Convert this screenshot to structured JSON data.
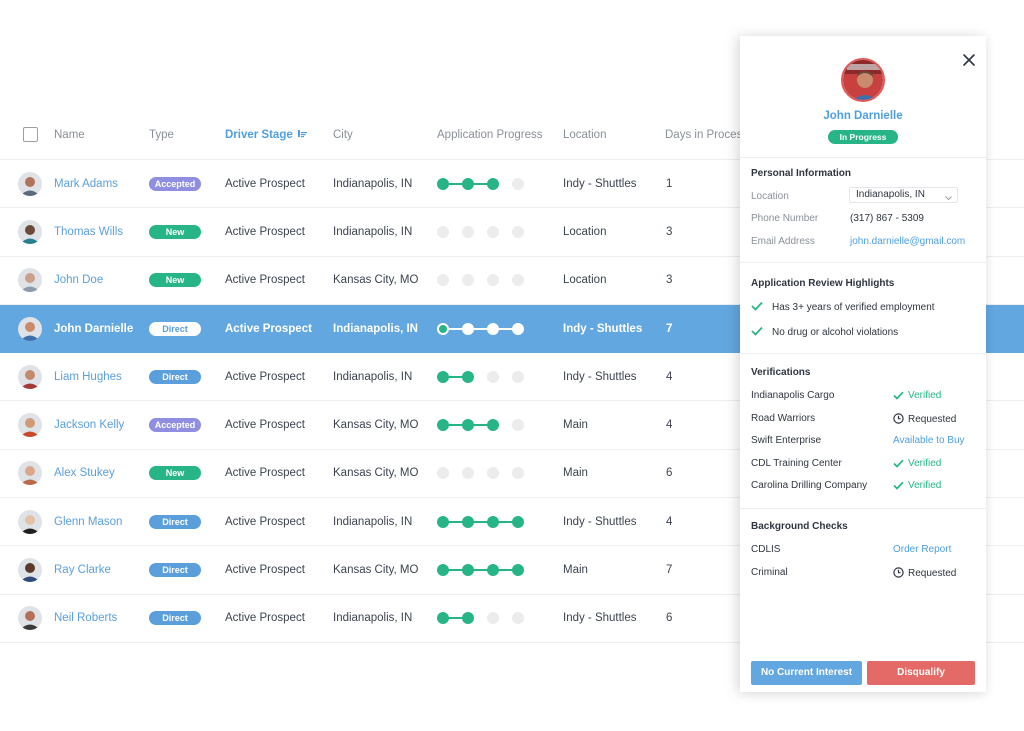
{
  "table": {
    "headers": {
      "name": "Name",
      "type": "Type",
      "stage": "Driver Stage",
      "city": "City",
      "progress": "Application Progress",
      "location": "Location",
      "days": "Days in Process"
    },
    "rows": [
      {
        "name": "Mark Adams",
        "type": "Accepted",
        "stage": "Active Prospect",
        "city": "Indianapolis, IN",
        "progress": 3,
        "location": "Indy - Shuttles",
        "days": "1",
        "avatar_color": "#b0735a",
        "shirt": "#5a6b7c"
      },
      {
        "name": "Thomas Wills",
        "type": "New",
        "stage": "Active Prospect",
        "city": "Indianapolis, IN",
        "progress": 0,
        "location": "Location",
        "days": "3",
        "avatar_color": "#6b4a3a",
        "shirt": "#2a7f8f"
      },
      {
        "name": "John Doe",
        "type": "New",
        "stage": "Active Prospect",
        "city": "Kansas City, MO",
        "progress": 0,
        "location": "Location",
        "days": "3",
        "avatar_color": "#caa08a",
        "shirt": "#8b9ba8"
      },
      {
        "name": "John Darnielle",
        "type": "Direct",
        "stage": "Active Prospect",
        "city": "Indianapolis, IN",
        "progress": 4,
        "location": "Indy - Shuttles",
        "days": "7",
        "avatar_color": "#c98b6c",
        "shirt": "#3f6fa8",
        "selected": true
      },
      {
        "name": "Liam Hughes",
        "type": "Direct",
        "stage": "Active Prospect",
        "city": "Indianapolis, IN",
        "progress": 2,
        "location": "Indy - Shuttles",
        "days": "4",
        "avatar_color": "#c48a6e",
        "shirt": "#a33a3a"
      },
      {
        "name": "Jackson Kelly",
        "type": "Accepted",
        "stage": "Active Prospect",
        "city": "Kansas City, MO",
        "progress": 3,
        "location": "Main",
        "days": "4",
        "avatar_color": "#d09a78",
        "shirt": "#c84a2e"
      },
      {
        "name": "Alex Stukey",
        "type": "New",
        "stage": "Active Prospect",
        "city": "Kansas City, MO",
        "progress": 0,
        "location": "Main",
        "days": "6",
        "avatar_color": "#d9a88a",
        "shirt": "#b86a4a"
      },
      {
        "name": "Glenn Mason",
        "type": "Direct",
        "stage": "Active Prospect",
        "city": "Indianapolis, IN",
        "progress": 4,
        "location": "Indy - Shuttles",
        "days": "4",
        "avatar_color": "#e2c2a8",
        "shirt": "#1f1f1f"
      },
      {
        "name": "Ray Clarke",
        "type": "Direct",
        "stage": "Active Prospect",
        "city": "Kansas City, MO",
        "progress": 4,
        "location": "Main",
        "days": "7",
        "avatar_color": "#5a3a2a",
        "shirt": "#2e4a7a"
      },
      {
        "name": "Neil Roberts",
        "type": "Direct",
        "stage": "Active Prospect",
        "city": "Indianapolis, IN",
        "progress": 2,
        "location": "Indy - Shuttles",
        "days": "6",
        "avatar_color": "#b4705a",
        "shirt": "#3a3a3a"
      }
    ]
  },
  "panel": {
    "name": "John Darnielle",
    "status": "In Progress",
    "personal": {
      "title": "Personal Information",
      "location_label": "Location",
      "location_value": "Indianapolis, IN",
      "phone_label": "Phone Number",
      "phone_value": "(317) 867 - 5309",
      "email_label": "Email Address",
      "email_value": "john.darnielle@gmail.com"
    },
    "highlights": {
      "title": "Application Review Highlights",
      "items": [
        "Has 3+ years of verified employment",
        "No drug or alcohol violations"
      ]
    },
    "verifications": {
      "title": "Verifications",
      "items": [
        {
          "name": "Indianapolis Cargo",
          "status": "Verified",
          "kind": "verified"
        },
        {
          "name": "Road Warriors",
          "status": "Requested",
          "kind": "requested"
        },
        {
          "name": "Swift Enterprise",
          "status": "Available to Buy",
          "kind": "link"
        },
        {
          "name": "CDL Training Center",
          "status": "Verified",
          "kind": "verified"
        },
        {
          "name": "Carolina Drilling Company",
          "status": "Verified",
          "kind": "verified"
        }
      ]
    },
    "background": {
      "title": "Background Checks",
      "items": [
        {
          "name": "CDLIS",
          "status": "Order Report",
          "kind": "link"
        },
        {
          "name": "Criminal",
          "status": "Requested",
          "kind": "requested"
        }
      ]
    },
    "buttons": {
      "no_interest": "No Current Interest",
      "disqualify": "Disqualify"
    }
  },
  "colors": {
    "accent_blue": "#4f9fe0",
    "selected_row": "#63a7e0",
    "green": "#27b588",
    "purple": "#8f8ee0",
    "red": "#e36a66"
  }
}
